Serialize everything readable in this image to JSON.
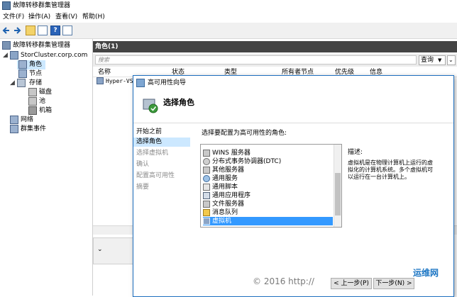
{
  "window": {
    "title": "故障转移群集管理器"
  },
  "menu": {
    "file": "文件(F)",
    "action": "操作(A)",
    "view": "查看(V)",
    "help": "帮助(H)"
  },
  "tree": {
    "root": "故障转移群集管理器",
    "cluster": "StorCluster.corp.com",
    "roles": "角色",
    "nodes": "节点",
    "storage": "存储",
    "disks": "磁盘",
    "pools": "池",
    "enclosures": "机箱",
    "networks": "网络",
    "events": "群集事件"
  },
  "main": {
    "header": "角色(1)",
    "search_placeholder": "搜索",
    "query_label": "查询",
    "columns": [
      "名称",
      "状态",
      "类型",
      "所有者节点",
      "优先级",
      "信息"
    ],
    "row_name": "Hyper-VS"
  },
  "wizard": {
    "title": "高可用性向导",
    "heading": "选择角色",
    "nav": [
      "开始之前",
      "选择角色",
      "选择虚拟机",
      "确认",
      "配置高可用性",
      "摘要"
    ],
    "instruction": "选择要配置为高可用性的角色:",
    "roles": [
      "WINS 服务器",
      "分布式事务协调器(DTC)",
      "其他服务器",
      "通用服务",
      "通用脚本",
      "通用应用程序",
      "文件服务器",
      "消息队列",
      "虚拟机"
    ],
    "selected_role": "虚拟机",
    "description_label": "描述:",
    "description_lines": [
      "虚拟机是在物理计算机上运行的虚",
      "拟化的计算机系统。多个虚拟机可",
      "以运行在一台计算机上。"
    ],
    "btn_prev": "< 上一步(P)",
    "btn_next": "下一步(N) >"
  },
  "watermark": "© 2016 http://",
  "logo": "运维网"
}
